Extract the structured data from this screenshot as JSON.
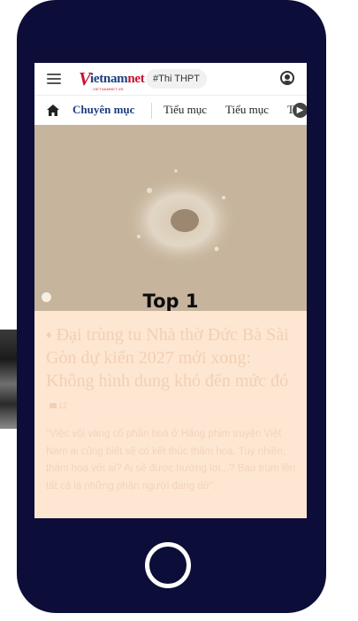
{
  "header": {
    "logo_text": "vietnamnet",
    "logo_sub": "VIETNAMNET.VN",
    "tag": "#Thi THPT"
  },
  "categories": {
    "main": "Chuyên mục",
    "sub": [
      "Tiểu mục",
      "Tiểu mục",
      "Ti"
    ]
  },
  "hero": {
    "rank_label": "Top 1"
  },
  "article": {
    "headline": "Đại trùng tu Nhà thờ Đức Bà Sài Gòn dự kiến 2027 mới xong: Không hình dung khó đến mức đó",
    "comment_count": "12",
    "summary": "\"Việc vội vàng cổ phần hoá ở Hãng phim truyện Việt Nam ai cũng biết sẽ có kết thúc thảm hoạ. Tuy nhiên, thảm hoạ với ai? Ai sẽ được hưởng lợi...? Bao trùm lên tất cả là những phận người đang dở\"."
  },
  "colors": {
    "phone_frame": "#0d0d3a",
    "brand_blue": "#1e3e7e",
    "brand_red": "#c8102e",
    "article_bg": "#fde7d2"
  },
  "icons": [
    "hamburger-menu-icon",
    "user-account-icon",
    "home-icon",
    "chevron-right-icon",
    "video-play-icon",
    "flame-icon",
    "comment-icon"
  ]
}
